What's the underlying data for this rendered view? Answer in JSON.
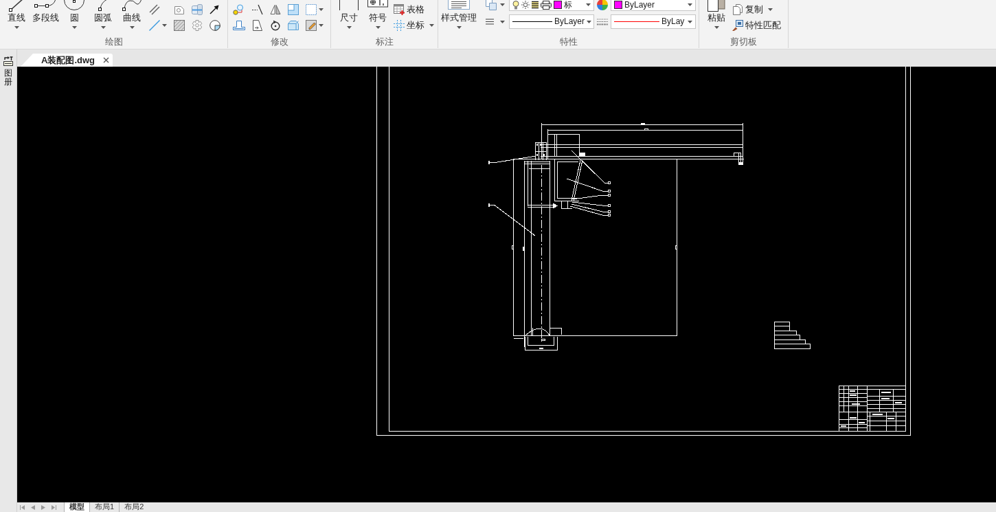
{
  "ribbon": {
    "groups": [
      {
        "label": "绘图",
        "columns": [
          {
            "kind": "large",
            "label": "直线",
            "dropdown": true
          },
          {
            "kind": "large",
            "label": "多段线",
            "dropdown": false
          },
          {
            "kind": "large",
            "label": "圆",
            "dropdown": true
          },
          {
            "kind": "large",
            "label": "圆弧",
            "dropdown": true
          },
          {
            "kind": "large",
            "label": "曲线",
            "dropdown": true
          },
          {
            "kind": "stack",
            "items": [
              {
                "kind": "icon",
                "dropdown": false
              },
              {
                "kind": "icon",
                "dropdown": true
              }
            ]
          },
          {
            "kind": "stack",
            "items": [
              {
                "kind": "icon",
                "dropdown": false
              },
              {
                "kind": "icon",
                "dropdown": false
              }
            ]
          },
          {
            "kind": "stack",
            "items": [
              {
                "kind": "icon",
                "dropdown": false
              },
              {
                "kind": "icon",
                "dropdown": false
              }
            ]
          },
          {
            "kind": "stack",
            "items": [
              {
                "kind": "icon",
                "dropdown": false
              },
              {
                "kind": "icon",
                "dropdown": false
              }
            ]
          }
        ]
      },
      {
        "label": "修改",
        "columns": [
          {
            "kind": "stack",
            "items": [
              {
                "kind": "icon",
                "dropdown": false
              },
              {
                "kind": "icon",
                "dropdown": false
              }
            ]
          },
          {
            "kind": "stack",
            "items": [
              {
                "kind": "icon",
                "dropdown": false
              },
              {
                "kind": "icon",
                "dropdown": false
              }
            ]
          },
          {
            "kind": "stack",
            "items": [
              {
                "kind": "icon",
                "dropdown": false
              },
              {
                "kind": "icon",
                "dropdown": false
              }
            ]
          },
          {
            "kind": "stack",
            "items": [
              {
                "kind": "icon",
                "dropdown": false
              },
              {
                "kind": "icon",
                "dropdown": false
              }
            ]
          },
          {
            "kind": "stack",
            "items": [
              {
                "kind": "icon",
                "dropdown": true
              },
              {
                "kind": "icon",
                "dropdown": true
              }
            ]
          }
        ]
      },
      {
        "label": "标注",
        "columns": [
          {
            "kind": "large",
            "label": "尺寸",
            "dropdown": true
          },
          {
            "kind": "large",
            "label": "符号",
            "dropdown": true
          },
          {
            "kind": "stack",
            "items": [
              {
                "kind": "small",
                "label": "表格",
                "dropdown": false
              },
              {
                "kind": "small",
                "label": "坐标",
                "dropdown": true
              }
            ]
          }
        ]
      },
      {
        "label": "特性",
        "columns": [
          {
            "kind": "large",
            "label": "样式管理",
            "dropdown": true
          },
          {
            "kind": "grid",
            "rows": [
              [
                {
                  "kind": "icon",
                  "dropdown": true
                },
                {
                  "kind": "layer",
                  "value": "标",
                  "color": "#ff00ff"
                },
                {
                  "kind": "icon",
                  "dropdown": false
                },
                {
                  "kind": "color",
                  "value": "ByLayer",
                  "color": "#ff00ff"
                }
              ],
              [
                {
                  "kind": "icon",
                  "dropdown": true
                },
                {
                  "kind": "linetype",
                  "value": "ByLayer",
                  "color": "#000000"
                },
                {
                  "kind": "icon",
                  "dropdown": false
                },
                {
                  "kind": "lineweight",
                  "value": "ByLay",
                  "color": "#ff0000"
                }
              ]
            ]
          }
        ]
      },
      {
        "label": "剪切板",
        "columns": [
          {
            "kind": "large",
            "label": "粘贴",
            "dropdown": true
          },
          {
            "kind": "stack",
            "items": [
              {
                "kind": "small",
                "label": "复制",
                "dropdown": true
              },
              {
                "kind": "small",
                "label": "特性匹配",
                "dropdown": false
              }
            ]
          }
        ]
      }
    ]
  },
  "side_panel": {
    "label": "图册"
  },
  "document_tabs": [
    {
      "label": "A装配图.dwg",
      "selected": true
    }
  ],
  "layout_tabs": [
    {
      "label": "模型",
      "selected": true
    },
    {
      "label": "布局1",
      "selected": false
    },
    {
      "label": "布局2",
      "selected": false
    }
  ]
}
